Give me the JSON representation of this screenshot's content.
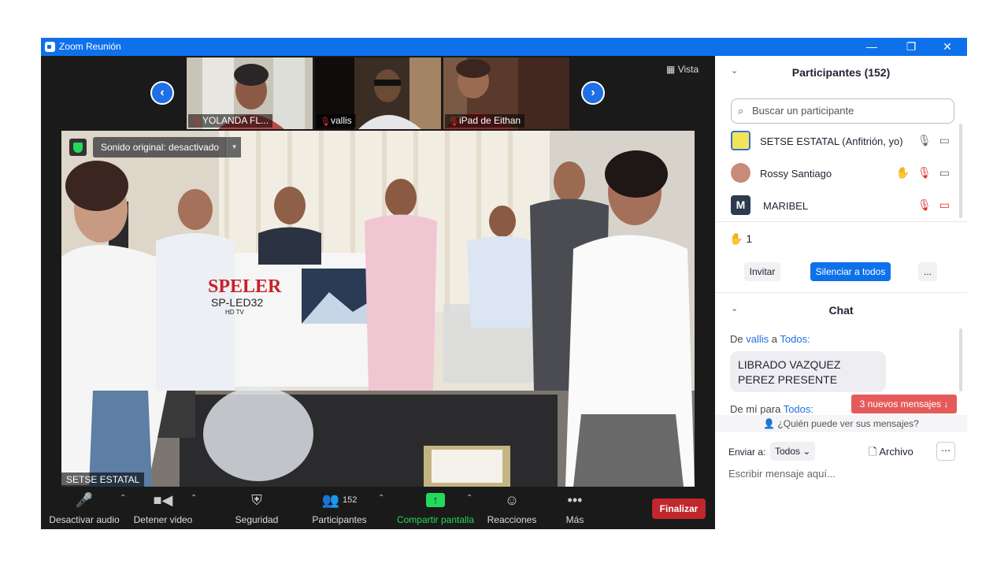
{
  "window": {
    "title": "Zoom Reunión",
    "minimize": "—",
    "restore": "❐",
    "close": "✕"
  },
  "view_button": "Vista",
  "thumbnails": [
    {
      "name": "YOLANDA FL..."
    },
    {
      "name": "vallis"
    },
    {
      "name": "iPad de Eithan"
    }
  ],
  "main_video": {
    "sound_status": "Sonido original: desactivado",
    "speaker": "SETSE ESTATAL",
    "box_brand": "SPELER",
    "box_model": "SP-LED32",
    "box_sub": "HD TV"
  },
  "toolbar": {
    "audio": "Desactivar audio",
    "video": "Detener video",
    "security": "Seguridad",
    "participants": "Participantes",
    "participants_count": "152",
    "share": "Compartir pantalla",
    "reactions": "Reacciones",
    "more": "Más",
    "end": "Finalizar"
  },
  "participants_panel": {
    "title": "Participantes (152)",
    "search_placeholder": "Buscar un participante",
    "list": [
      {
        "name": "SETSE ESTATAL (Anfitrión, yo)"
      },
      {
        "name": "Rossy Santiago"
      },
      {
        "name": "MARIBEL",
        "initial": "M"
      }
    ],
    "raised_hands": "1",
    "invite": "Invitar",
    "mute_all": "Silenciar a todos",
    "more": "..."
  },
  "chat": {
    "title": "Chat",
    "msg1_prefix": "De",
    "msg1_from": "vallis",
    "msg1_mid": "a",
    "msg1_to": "Todos:",
    "msg1_text": "LIBRADO VAZQUEZ PEREZ PRESENTE",
    "msg2_prefix": "De mí para",
    "msg2_to": "Todos:",
    "new_messages": "3 nuevos mensajes ↓",
    "who_can_see": "¿Quién puede ver sus mensajes?",
    "send_to_label": "Enviar a:",
    "send_to_value": "Todos",
    "file_label": "Archivo",
    "input_placeholder": "Escribir mensaje aquí..."
  },
  "colors": {
    "accent": "#0e71eb",
    "end": "#c0282d",
    "muted_red": "#e02828",
    "share_green": "#23d959"
  }
}
